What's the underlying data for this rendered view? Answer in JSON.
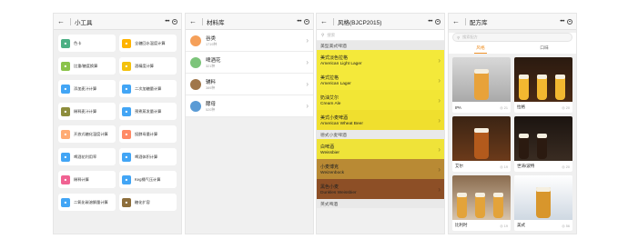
{
  "screens": {
    "tools": {
      "title": "小工具",
      "items": [
        {
          "label": "色卡",
          "icon": "color-card-icon",
          "color": "#4caf84"
        },
        {
          "label": "全糖回水温度计算",
          "icon": "temperature-icon",
          "color": "#ffb300"
        },
        {
          "label": "比重/糖度换算",
          "icon": "hydrometer-icon",
          "color": "#8bc34a"
        },
        {
          "label": "酒精度计算",
          "icon": "alcohol-icon",
          "color": "#f4c20d"
        },
        {
          "label": "添加麦汁计算",
          "icon": "wort-add-icon",
          "color": "#42a5f5"
        },
        {
          "label": "二次加糖量计算",
          "icon": "sugar-icon",
          "color": "#42a5f5"
        },
        {
          "label": "稀释麦汁计算",
          "icon": "dilute-icon",
          "color": "#8d8d3c"
        },
        {
          "label": "预煮蒸发量计算",
          "icon": "evaporation-icon",
          "color": "#42a5f5"
        },
        {
          "label": "开放式糖化温度计算",
          "icon": "mash-temp-icon",
          "color": "#ffab73"
        },
        {
          "label": "投酵母量计算",
          "icon": "yeast-icon",
          "color": "#ff8a65"
        },
        {
          "label": "啤酒花利用率",
          "icon": "hops-icon",
          "color": "#42a5f5"
        },
        {
          "label": "啤酒体积计算",
          "icon": "volume-icon",
          "color": "#42a5f5"
        },
        {
          "label": "稀释计算",
          "icon": "dilution-icon",
          "color": "#f06292"
        },
        {
          "label": "Keg桶气压计算",
          "icon": "keg-icon",
          "color": "#42a5f5"
        },
        {
          "label": "二氧化碳溶解量计算",
          "icon": "co2-icon",
          "color": "#42a5f5"
        },
        {
          "label": "糖化扩容",
          "icon": "mash-expand-icon",
          "color": "#8d6e3c"
        }
      ]
    },
    "ingredients": {
      "title": "材料库",
      "items": [
        {
          "name": "谷类",
          "count": "1719种",
          "icon": "grain-icon",
          "color": "#f5a05a"
        },
        {
          "name": "啤酒花",
          "count": "321种",
          "icon": "hop-icon",
          "color": "#7cc47a"
        },
        {
          "name": "辅料",
          "count": "389种",
          "icon": "adjunct-icon",
          "color": "#a0764a"
        },
        {
          "name": "酵母",
          "count": "520种",
          "icon": "yeast-icon",
          "color": "#5a9bd5"
        }
      ]
    },
    "styles": {
      "title": "风格(BJCP2015)",
      "search_placeholder": "搜索",
      "rows": [
        {
          "type": "category",
          "label": "美型美式啤酒"
        },
        {
          "type": "style",
          "zh": "美式淡色拉格",
          "en": "American Light Lager",
          "color": "#f4e93a"
        },
        {
          "type": "style",
          "zh": "美式拉格",
          "en": "American Lager",
          "color": "#f4e93a"
        },
        {
          "type": "style",
          "zh": "奶油艾尔",
          "en": "Cream Ale",
          "color": "#f2e635"
        },
        {
          "type": "style",
          "zh": "美式小麦啤酒",
          "en": "American Wheat Beer",
          "color": "#f0df2e"
        },
        {
          "type": "category",
          "label": "德式小麦啤酒"
        },
        {
          "type": "style",
          "zh": "白啤酒",
          "en": "Weissbier",
          "color": "#efe339"
        },
        {
          "type": "style",
          "zh": "小麦博克",
          "en": "Weizenbock",
          "color": "#b98a34"
        },
        {
          "type": "style",
          "zh": "黑色小麦",
          "en": "Dunkles Weissbier",
          "color": "#8d4f26"
        },
        {
          "type": "category",
          "label": "英式啤酒"
        }
      ]
    },
    "recipes": {
      "title": "配方库",
      "search_placeholder": "搜索配方",
      "tabs": [
        "风格",
        "口味"
      ],
      "active_tab": 0,
      "cards": [
        {
          "name": "IPA",
          "likes": "21"
        },
        {
          "name": "拉格",
          "likes": "20"
        },
        {
          "name": "艾尔",
          "likes": "19"
        },
        {
          "name": "世涛/波特",
          "likes": "20"
        },
        {
          "name": "比利时",
          "likes": "19"
        },
        {
          "name": "美式",
          "likes": "56"
        }
      ]
    }
  }
}
